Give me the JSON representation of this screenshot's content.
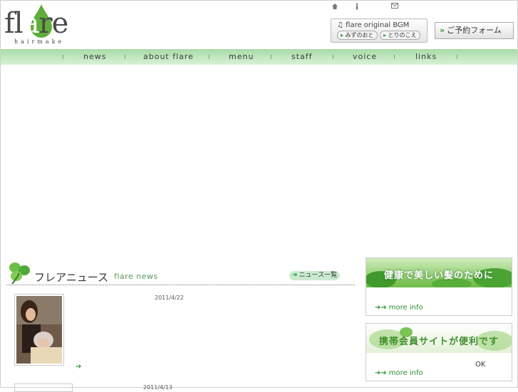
{
  "brand": {
    "logo_word_before": "fl",
    "logo_letter": "a",
    "logo_word_after": "re",
    "logo_sub": "hairmake"
  },
  "utility": {
    "home_icon": "home-icon",
    "info_icon": "info-icon",
    "mail_icon": "mail-icon"
  },
  "bgm": {
    "title": "flare original BGM",
    "track1": "みずのおと",
    "track2": "とりのこえ"
  },
  "reserve_label": "ご予約フォーム",
  "nav": {
    "items": [
      "news",
      "about flare",
      "menu",
      "staff",
      "voice",
      "links"
    ]
  },
  "news": {
    "title": "フレアニュース",
    "subtitle": "flare news",
    "list_button": "ニュース一覧",
    "items": [
      {
        "date": "2011/4/22"
      },
      {
        "date": "2011/4/13"
      }
    ]
  },
  "banners": [
    {
      "title": "健康で美しい髪のために",
      "more": "more info"
    },
    {
      "title": "携帯会員サイトが便利です",
      "more": "more info"
    }
  ],
  "ok_label": "OK",
  "colors": {
    "accent_green": "#2d9a37",
    "nav_bg": "#bfe6bd"
  }
}
